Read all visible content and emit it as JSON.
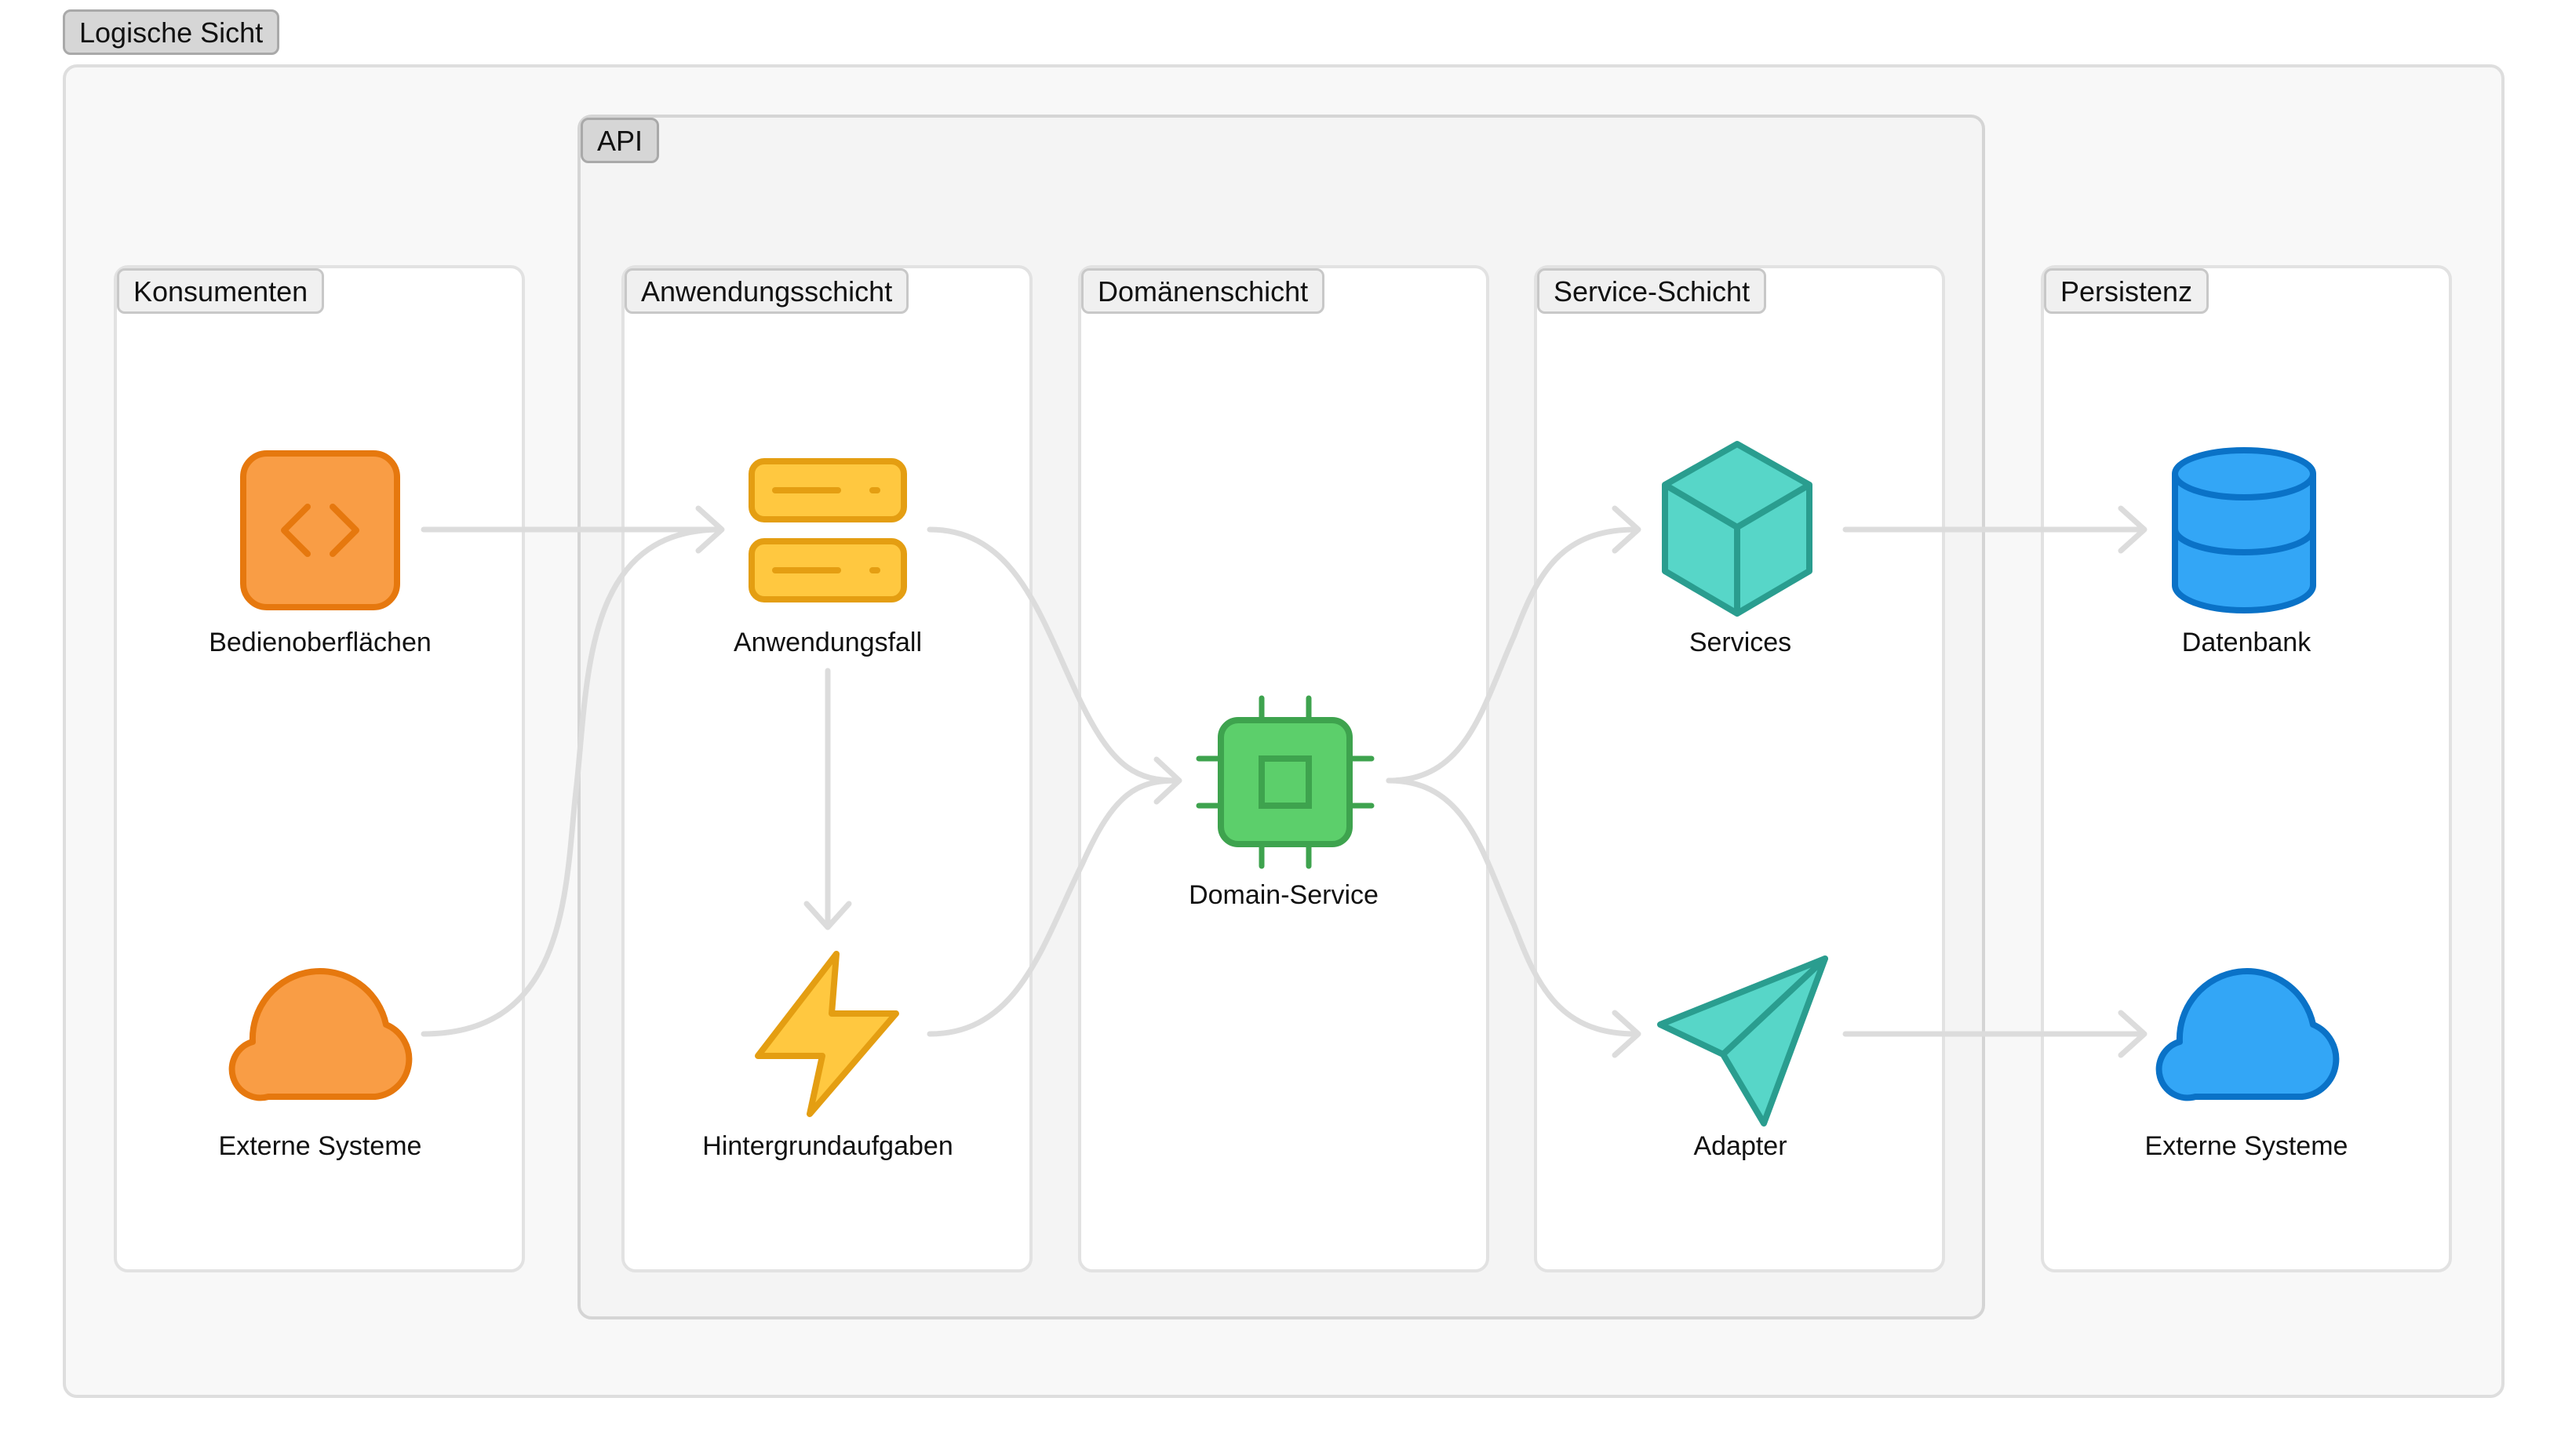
{
  "diagram": {
    "title": "Logische Sicht",
    "api_group": "API",
    "lanes": {
      "consumers": "Konsumenten",
      "application": "Anwendungsschicht",
      "domain": "Domänenschicht",
      "service": "Service-Schicht",
      "persistence": "Persistenz"
    },
    "nodes": {
      "ui": {
        "label": "Bedienoberflächen",
        "icon": "code-window-icon",
        "color": "#f99d45"
      },
      "ext_in": {
        "label": "Externe Systeme",
        "icon": "cloud-icon",
        "color": "#f99d45"
      },
      "usecase": {
        "label": "Anwendungsfall",
        "icon": "server-icon",
        "color": "#ffc840"
      },
      "jobs": {
        "label": "Hintergrundaufgaben",
        "icon": "lightning-icon",
        "color": "#ffc840"
      },
      "domain": {
        "label": "Domain-Service",
        "icon": "cpu-chip-icon",
        "color": "#5ccf6b"
      },
      "services": {
        "label": "Services",
        "icon": "cube-icon",
        "color": "#57d6c8"
      },
      "adapter": {
        "label": "Adapter",
        "icon": "paper-plane-icon",
        "color": "#57d6c8"
      },
      "db": {
        "label": "Datenbank",
        "icon": "database-icon",
        "color": "#33a6f6"
      },
      "ext_out": {
        "label": "Externe Systeme",
        "icon": "cloud-icon",
        "color": "#33a6f6"
      }
    },
    "edge_color": "#dcdcdc"
  }
}
